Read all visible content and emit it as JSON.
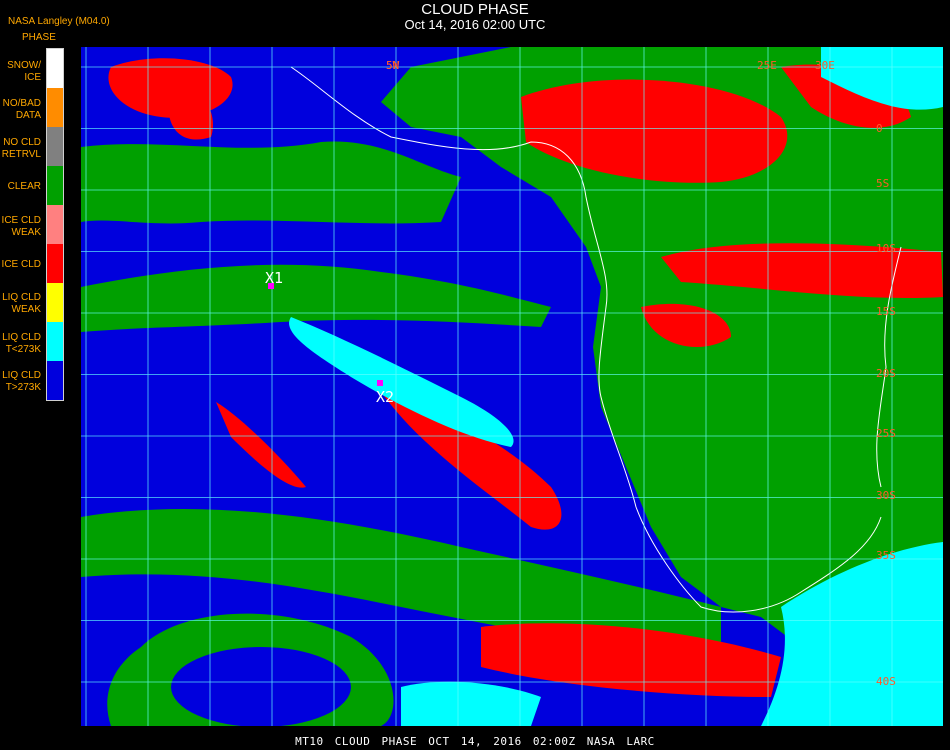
{
  "header": {
    "title": "CLOUD PHASE",
    "subtitle": "Oct 14, 2016 02:00 UTC",
    "producer": "NASA Langley (M04.0)"
  },
  "legend": {
    "title": "PHASE",
    "items": [
      {
        "label": "SNOW/\nICE",
        "color": "#ffffff"
      },
      {
        "label": "NO/BAD\nDATA",
        "color": "#ff8c00"
      },
      {
        "label": "NO CLD\nRETRVL",
        "color": "#808080"
      },
      {
        "label": "CLEAR",
        "color": "#00a000"
      },
      {
        "label": "ICE CLD\nWEAK",
        "color": "#ff8080"
      },
      {
        "label": "ICE CLD",
        "color": "#ff0000"
      },
      {
        "label": "LIQ CLD\nWEAK",
        "color": "#ffff00"
      },
      {
        "label": "LIQ CLD\nT<273K",
        "color": "#00ffff"
      },
      {
        "label": "LIQ CLD\nT>273K",
        "color": "#0000dd"
      }
    ]
  },
  "map": {
    "grid_color": "#66ffff",
    "coast_color": "#ffffff",
    "lat_labels": [
      "5N",
      "0",
      "5S",
      "10S",
      "15S",
      "20S",
      "25S",
      "30S",
      "35S",
      "40S"
    ],
    "lon_labels": [
      "5W",
      "25E",
      "30E"
    ],
    "markers": [
      {
        "label": "X1",
        "color": "#ff00ff"
      },
      {
        "label": "X2",
        "color": "#ff00ff"
      }
    ]
  },
  "footer": "MT10   CLOUD PHASE   OCT 14, 2016 02:00Z   NASA LARC"
}
